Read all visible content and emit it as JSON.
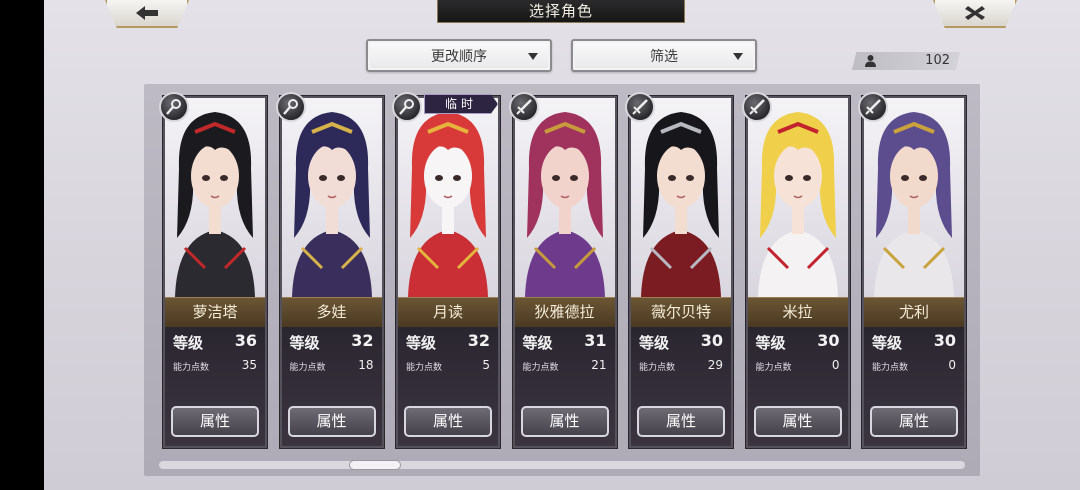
{
  "header": {
    "title": "选择角色",
    "back_icon": "arrow-left-icon",
    "close_icon": "x-close-icon"
  },
  "filters": {
    "order_label": "更改顺序",
    "filter_label": "筛选"
  },
  "character_count": "102",
  "temp_label": "临时",
  "level_label": "等级",
  "ability_points_label": "能力点数",
  "attribute_button_label": "属性",
  "characters": [
    {
      "name": "萝洁塔",
      "level": "36",
      "ability_points": "35",
      "type_icon": "staff-icon",
      "temporary": false,
      "hair": "#1b1b1f",
      "skin": "#f2ddd0",
      "outfit": "#2a2a30",
      "accent": "#c0282a"
    },
    {
      "name": "多娃",
      "level": "32",
      "ability_points": "18",
      "type_icon": "staff-icon",
      "temporary": false,
      "hair": "#2d2a5a",
      "skin": "#f1dcd6",
      "outfit": "#3a2f5c",
      "accent": "#d6b24a"
    },
    {
      "name": "月读",
      "level": "32",
      "ability_points": "5",
      "type_icon": "staff-icon",
      "temporary": true,
      "hair": "#d83a3a",
      "skin": "#f7f5f5",
      "outfit": "#c92f35",
      "accent": "#e4b43c"
    },
    {
      "name": "狄雅德拉",
      "level": "31",
      "ability_points": "21",
      "type_icon": "sword-icon",
      "temporary": false,
      "hair": "#a0335e",
      "skin": "#f1d3cc",
      "outfit": "#6e3a8c",
      "accent": "#c79a3c"
    },
    {
      "name": "薇尔贝特",
      "level": "30",
      "ability_points": "29",
      "type_icon": "sword-icon",
      "temporary": false,
      "hair": "#17171b",
      "skin": "#f3ddd1",
      "outfit": "#7a1c22",
      "accent": "#b8b8c0"
    },
    {
      "name": "米拉",
      "level": "30",
      "ability_points": "0",
      "type_icon": "sword-icon",
      "temporary": false,
      "hair": "#f0cf4a",
      "skin": "#f6e2d6",
      "outfit": "#f4f2f2",
      "accent": "#c2232e"
    },
    {
      "name": "尤利",
      "level": "30",
      "ability_points": "0",
      "type_icon": "sword-icon",
      "temporary": false,
      "hair": "#5c4d8e",
      "skin": "#f1d9cc",
      "outfit": "#e9e7ea",
      "accent": "#c9a23e"
    }
  ]
}
